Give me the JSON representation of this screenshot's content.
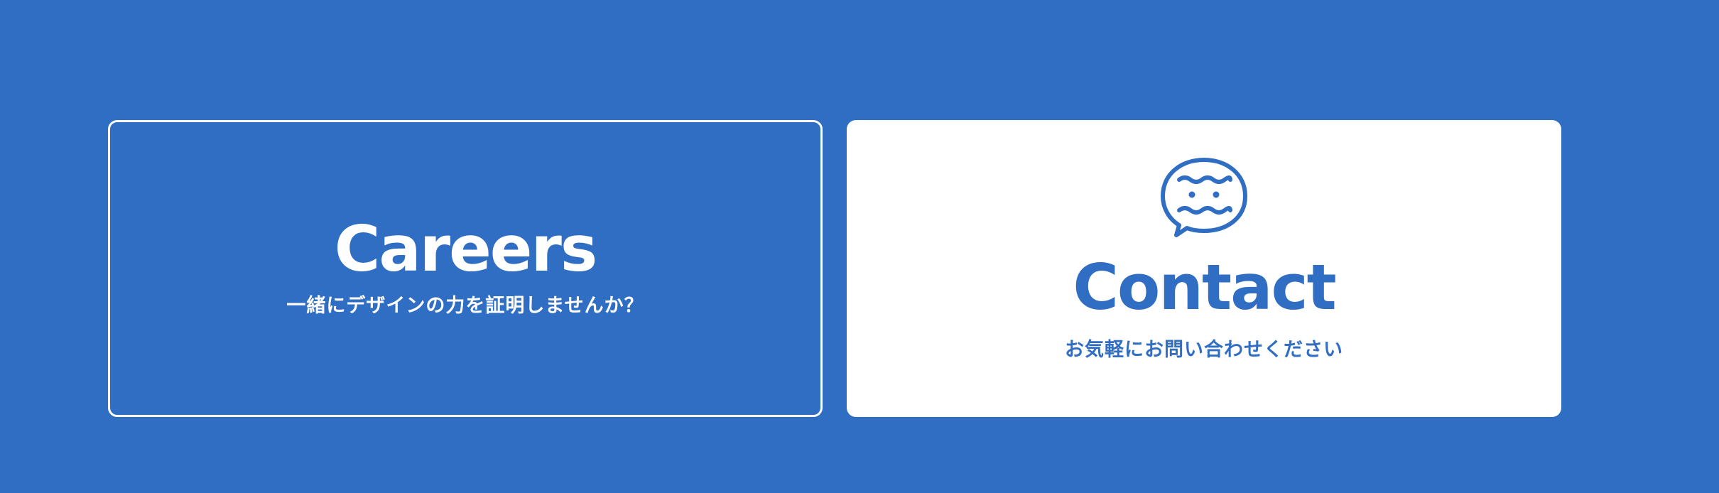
{
  "colors": {
    "background": "#306ec4",
    "card_light": "#ffffff",
    "accent": "#306ec4"
  },
  "careers": {
    "title": "Careers",
    "subtitle": "一緒にデザインの力を証明しませんか？"
  },
  "contact": {
    "icon": "chat-bubble-face-icon",
    "title": "Contact",
    "subtitle": "お気軽にお問い合わせください"
  }
}
